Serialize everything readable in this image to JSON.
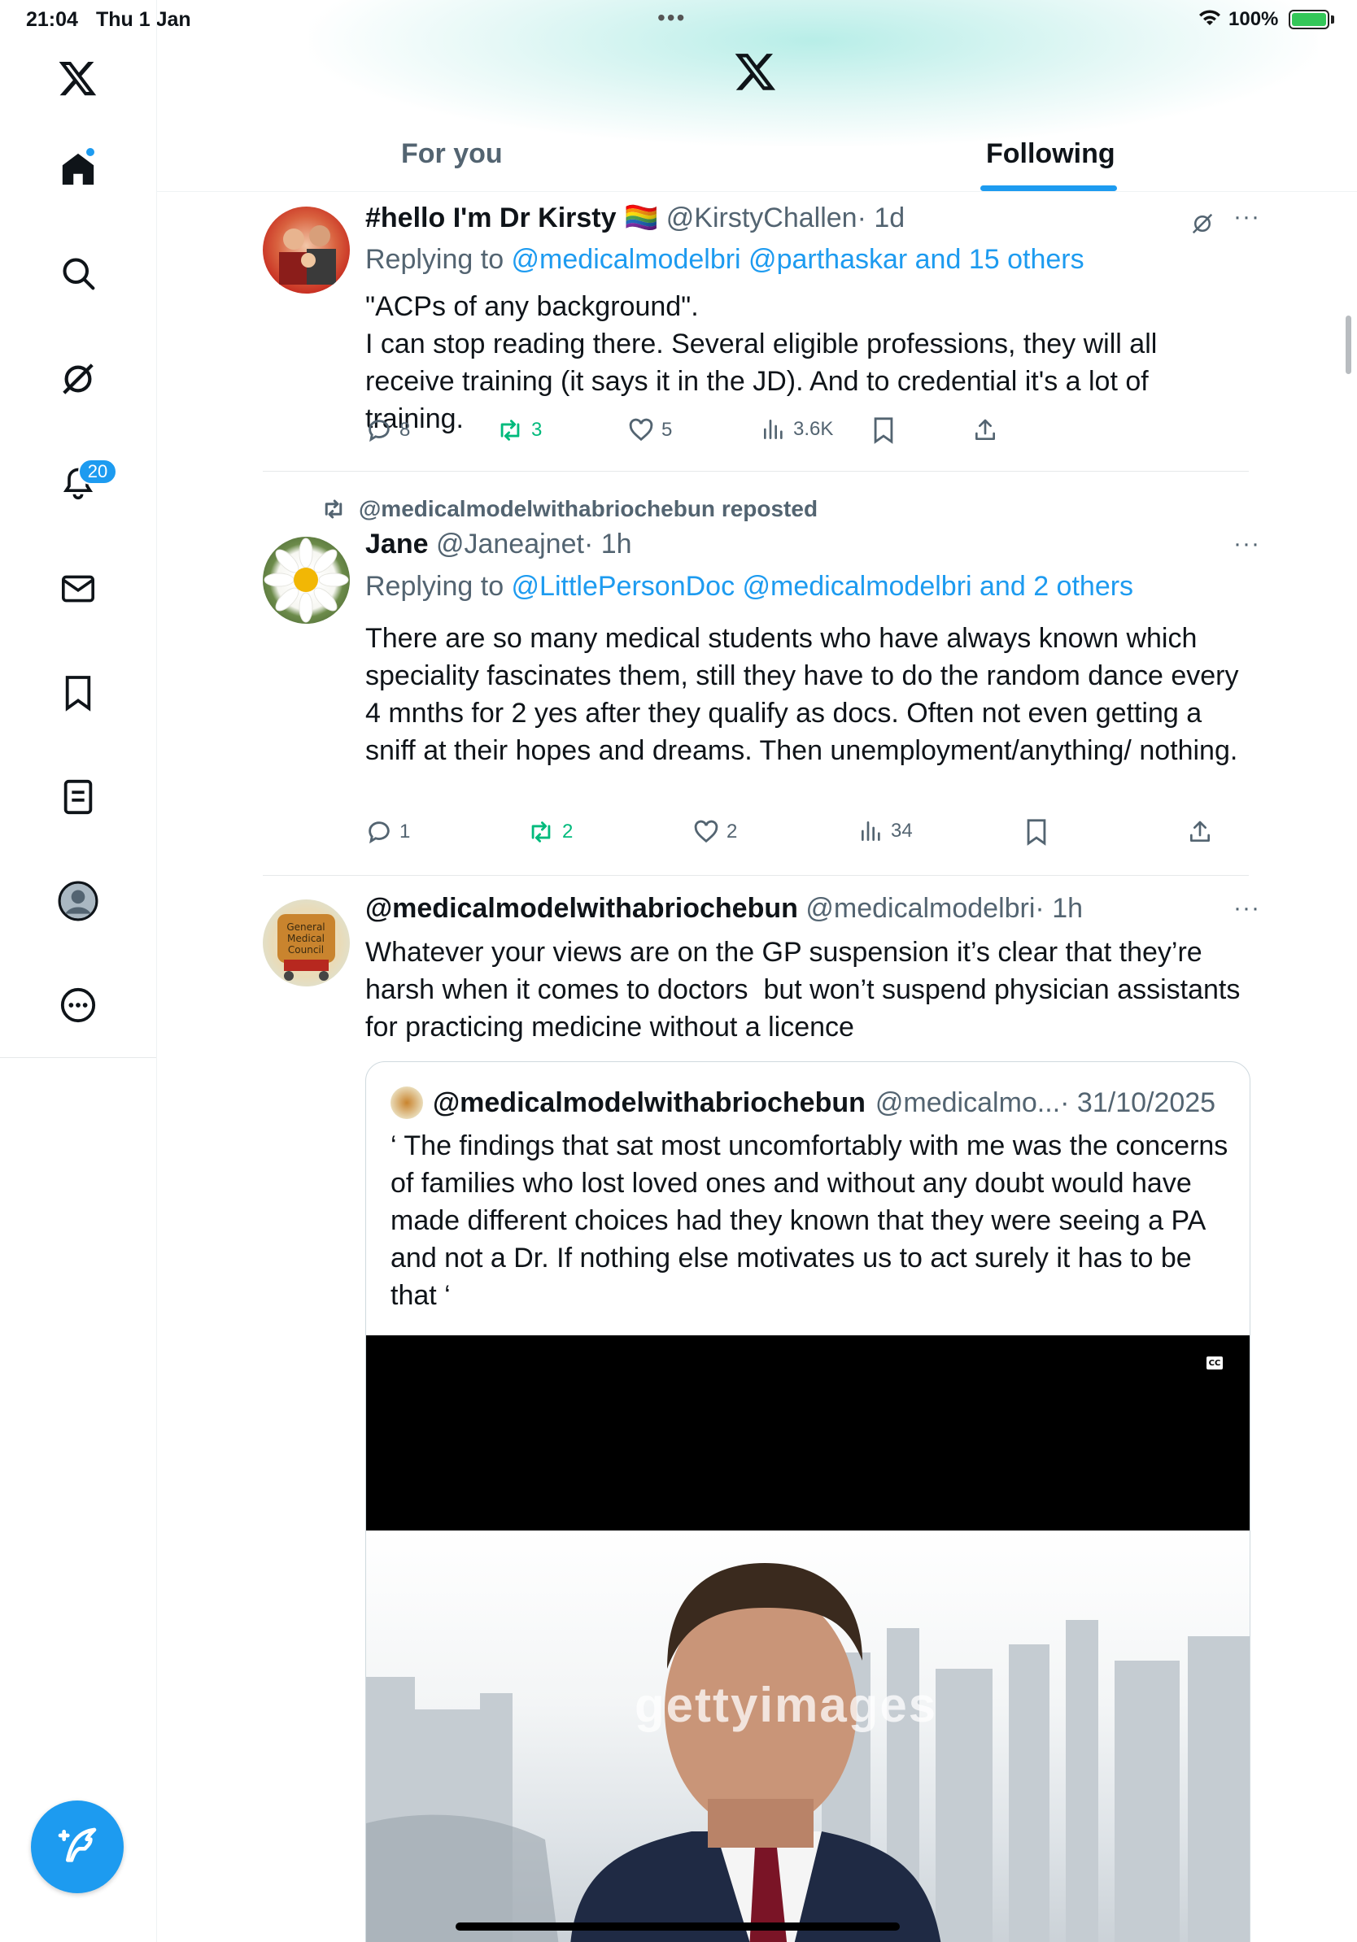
{
  "status_bar": {
    "time": "21:04",
    "date": "Thu 1 Jan",
    "battery": "100%"
  },
  "colors": {
    "accent": "#1d9bf0",
    "repost_green": "#00ba7c",
    "muted_text": "#536471",
    "primary_text": "#0f1419"
  },
  "sidebar": {
    "items": [
      {
        "name": "x-logo-icon"
      },
      {
        "name": "home-icon"
      },
      {
        "name": "search-icon"
      },
      {
        "name": "grok-icon"
      },
      {
        "name": "bell-icon"
      },
      {
        "name": "mail-icon"
      },
      {
        "name": "bookmark-icon"
      },
      {
        "name": "lists-icon"
      },
      {
        "name": "profile-icon"
      },
      {
        "name": "more-icon"
      }
    ],
    "notification_count": "20",
    "compose_icon": "compose-icon"
  },
  "tabs": {
    "for_you": "For you",
    "following": "Following"
  },
  "tweets": [
    {
      "name": "#hello I'm Dr Kirsty 🏳️‍🌈",
      "handle": "@KirstyChallen",
      "time": "· 1d",
      "reply_prefix": "Replying to ",
      "reply_to": "@medicalmodelbri @parthaskar and 15 others",
      "text": "\"ACPs of any background\".\nI can stop reading there. Several eligible professions, they will all receive training (it says it in the JD). And to credential it's a lot of training.",
      "replies": "8",
      "reposts": "3",
      "likes": "5",
      "views": "3.6K"
    },
    {
      "repost_label": "@medicalmodelwithabriochebun reposted",
      "name": "Jane",
      "handle": "@Janeajnet",
      "time": "· 1h",
      "reply_prefix": "Replying to ",
      "reply_to": "@LittlePersonDoc @medicalmodelbri and 2 others",
      "text": "There are so many medical students who have always known which speciality fascinates them, still they have to do the random dance every 4 mnths for 2 yes after they qualify as docs. Often not even getting a sniff at their hopes and dreams. Then unemployment/anything/ nothing.",
      "replies": "1",
      "reposts": "2",
      "likes": "2",
      "views": "34"
    },
    {
      "name": "@medicalmodelwithabriochebun",
      "handle": "@medicalmodelbri",
      "time": "· 1h",
      "text": "Whatever your views are on the GP suspension it’s clear that they’re harsh when it comes to doctors  but won’t suspend physician assistants for practicing medicine without a licence",
      "quote": {
        "name": "@medicalmodelwithabriochebun",
        "handle": "@medicalmo...",
        "time": "· 31/10/2025",
        "text": "‘ The findings that sat most uncomfortably with me was the concerns of families who lost loved ones and without any doubt would have made different choices had they known that they were seeing a PA and not a Dr. If nothing else motivates us to act surely it has to be that ‘",
        "cc_label": "CC",
        "watermark": "gettyimages"
      }
    }
  ]
}
